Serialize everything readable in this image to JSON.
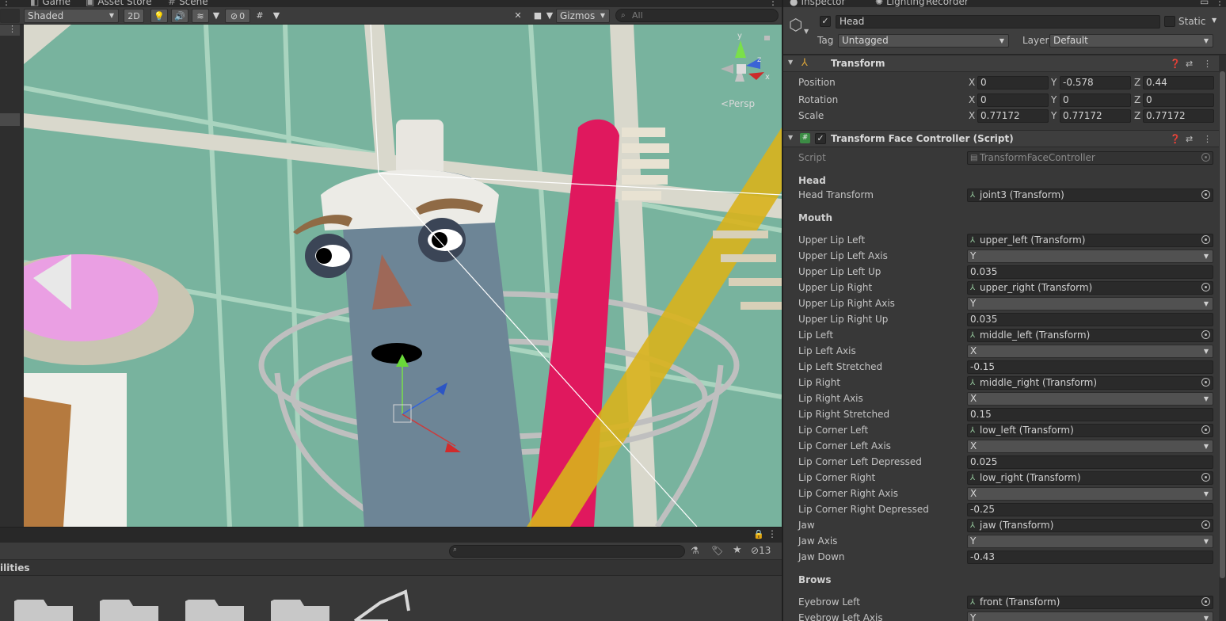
{
  "scene_tabs": {
    "game": "Game",
    "asset_store": "Asset Store",
    "scene": "Scene"
  },
  "scene_toolbar": {
    "shading_mode": "Shaded",
    "mode_2d": "2D",
    "hidden_count": "0",
    "gizmos": "Gizmos",
    "search_placeholder": "All"
  },
  "scene_view": {
    "projection_label": "Persp",
    "gizmo_axes": {
      "y": "y",
      "x": "x",
      "z": "z"
    }
  },
  "project_panel": {
    "breadcrumb": "ilities",
    "hidden_count": "13",
    "folder_icon": "folder-icon"
  },
  "inspector_tabs": {
    "inspector": "Inspector",
    "lighting": "Lighting",
    "recorder": "Recorder"
  },
  "object": {
    "name": "Head",
    "active": true,
    "static_label": "Static",
    "tag_label": "Tag",
    "tag": "Untagged",
    "layer_label": "Layer",
    "layer": "Default"
  },
  "transform": {
    "title": "Transform",
    "rows": [
      {
        "label": "Position",
        "x": "0",
        "y": "-0.578",
        "z": "0.44"
      },
      {
        "label": "Rotation",
        "x": "0",
        "y": "0",
        "z": "0"
      },
      {
        "label": "Scale",
        "x": "0.77172",
        "y": "0.77172",
        "z": "0.77172"
      }
    ],
    "axis_x": "X",
    "axis_y": "Y",
    "axis_z": "Z"
  },
  "face_controller": {
    "title": "Transform Face Controller (Script)",
    "script_label": "Script",
    "script_value": "TransformFaceController",
    "head_section": "Head",
    "head_transform_label": "Head Transform",
    "head_transform_value": "joint3 (Transform)",
    "mouth_section": "Mouth",
    "mouth_fields": [
      {
        "label": "Upper Lip Left",
        "type": "object",
        "value": "upper_left (Transform)"
      },
      {
        "label": "Upper Lip Left Axis",
        "type": "enum",
        "value": "Y"
      },
      {
        "label": "Upper Lip Left Up",
        "type": "number",
        "value": "0.035"
      },
      {
        "label": "Upper Lip Right",
        "type": "object",
        "value": "upper_right (Transform)"
      },
      {
        "label": "Upper Lip Right Axis",
        "type": "enum",
        "value": "Y"
      },
      {
        "label": "Upper Lip Right Up",
        "type": "number",
        "value": "0.035"
      },
      {
        "label": "Lip Left",
        "type": "object",
        "value": "middle_left (Transform)"
      },
      {
        "label": "Lip Left Axis",
        "type": "enum",
        "value": "X"
      },
      {
        "label": "Lip Left Stretched",
        "type": "number",
        "value": "-0.15"
      },
      {
        "label": "Lip Right",
        "type": "object",
        "value": "middle_right (Transform)"
      },
      {
        "label": "Lip Right Axis",
        "type": "enum",
        "value": "X"
      },
      {
        "label": "Lip Right Stretched",
        "type": "number",
        "value": "0.15"
      },
      {
        "label": "Lip Corner Left",
        "type": "object",
        "value": "low_left (Transform)"
      },
      {
        "label": "Lip Corner Left Axis",
        "type": "enum",
        "value": "X"
      },
      {
        "label": "Lip Corner Left Depressed",
        "type": "number",
        "value": "0.025"
      },
      {
        "label": "Lip Corner Right",
        "type": "object",
        "value": "low_right (Transform)"
      },
      {
        "label": "Lip Corner Right Axis",
        "type": "enum",
        "value": "X"
      },
      {
        "label": "Lip Corner Right Depressed",
        "type": "number",
        "value": "-0.25"
      },
      {
        "label": "Jaw",
        "type": "object",
        "value": "jaw (Transform)"
      },
      {
        "label": "Jaw Axis",
        "type": "enum",
        "value": "Y"
      },
      {
        "label": "Jaw Down",
        "type": "number",
        "value": "-0.43"
      }
    ],
    "brows_section": "Brows",
    "brows_fields": [
      {
        "label": "Eyebrow Left",
        "type": "object",
        "value": "front (Transform)"
      },
      {
        "label": "Eyebrow Left Axis",
        "type": "enum",
        "value": "Y"
      }
    ]
  },
  "colors": {
    "editor_bg": "#383838",
    "viewport_bg": "#77b19c",
    "toothbrush_pink": "#e0185e",
    "toothbrush_yellow": "#d8b21c"
  }
}
